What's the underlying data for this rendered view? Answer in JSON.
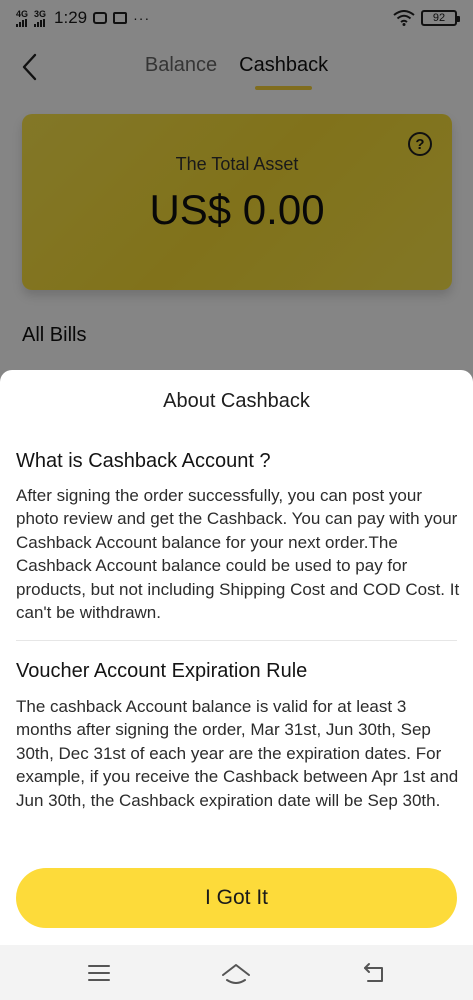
{
  "status_bar": {
    "network_1": "4G",
    "network_2": "3G",
    "time": "1:29",
    "more": "···",
    "battery": "92"
  },
  "header": {
    "tabs": [
      {
        "label": "Balance",
        "active": false
      },
      {
        "label": "Cashback",
        "active": true
      }
    ]
  },
  "asset_card": {
    "label": "The Total Asset",
    "value": "US$ 0.00"
  },
  "bills": {
    "title": "All Bills"
  },
  "sheet": {
    "title": "About Cashback",
    "sections": [
      {
        "title": "What is Cashback Account ?",
        "body": "After signing the order successfully, you can post your photo review and get the Cashback. You can pay with your Cashback Account balance for your next order.The Cashback Account balance could be used to pay for products, but not including Shipping Cost and COD Cost. It can't be withdrawn."
      },
      {
        "title": "Voucher Account Expiration Rule",
        "body": "The cashback Account balance is valid for at least 3 months after signing the order, Mar 31st, Jun 30th, Sep 30th, Dec 31st of each year are the expiration dates. For example, if you receive the Cashback between Apr 1st and Jun 30th, the Cashback expiration date will be Sep 30th."
      }
    ],
    "confirm_label": "I Got It"
  },
  "colors": {
    "accent_yellow": "#fddb3a",
    "overlay": "rgba(0,0,0,0.48)"
  },
  "icons": {
    "back": "chevron-left-icon",
    "help": "question-circle-icon",
    "menu": "menu-icon",
    "home": "home-icon",
    "return": "return-icon"
  }
}
